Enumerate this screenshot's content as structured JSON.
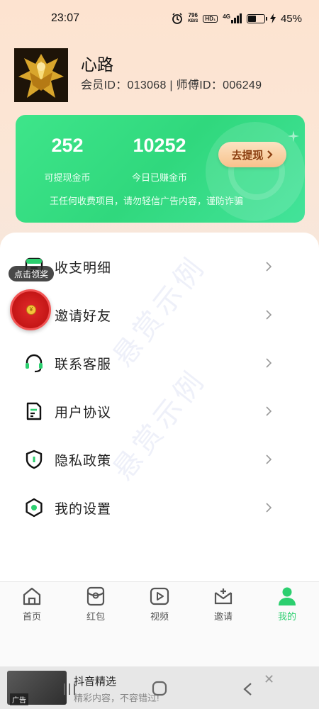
{
  "status_bar": {
    "time": "23:07",
    "speed_value": "796",
    "speed_unit": "KB/S",
    "hd_label": "HD₁",
    "network": "4G",
    "battery_text": "45%",
    "battery_level": 0.45
  },
  "profile": {
    "name": "心路",
    "ids": "会员ID：013068 | 师傅ID：006249"
  },
  "coins": {
    "withdrawable_value": "252",
    "withdrawable_label": "可提现金币",
    "today_value": "10252",
    "today_label": "今日已赚金币",
    "withdraw_button": "去提现",
    "notice": "王任何收费项目，请勿轻信广告内容，谨防诈骗"
  },
  "menu": {
    "items": [
      {
        "label": "收支明细",
        "icon": "ledger-icon"
      },
      {
        "label": "邀请好友",
        "icon": "invite-icon"
      },
      {
        "label": "联系客服",
        "icon": "headset-icon"
      },
      {
        "label": "用户协议",
        "icon": "document-icon"
      },
      {
        "label": "隐私政策",
        "icon": "shield-icon"
      },
      {
        "label": "我的设置",
        "icon": "settings-icon"
      }
    ]
  },
  "watermark": "悬赏示例",
  "reward": {
    "bubble": "点击领奖",
    "coin": "¥"
  },
  "bottom_nav": {
    "items": [
      {
        "label": "首页",
        "icon": "home-icon"
      },
      {
        "label": "红包",
        "icon": "red-packet-icon"
      },
      {
        "label": "视频",
        "icon": "video-icon"
      },
      {
        "label": "邀请",
        "icon": "invite-nav-icon"
      },
      {
        "label": "我的",
        "icon": "profile-icon",
        "active": true
      }
    ]
  },
  "ad": {
    "tag": "广告",
    "title": "抖音精选",
    "subtitle": "精彩内容，不容错过!"
  },
  "colors": {
    "accent_green": "#2ccf6f",
    "card_green": "#3ee58a",
    "reward_red": "#d21c1c"
  }
}
